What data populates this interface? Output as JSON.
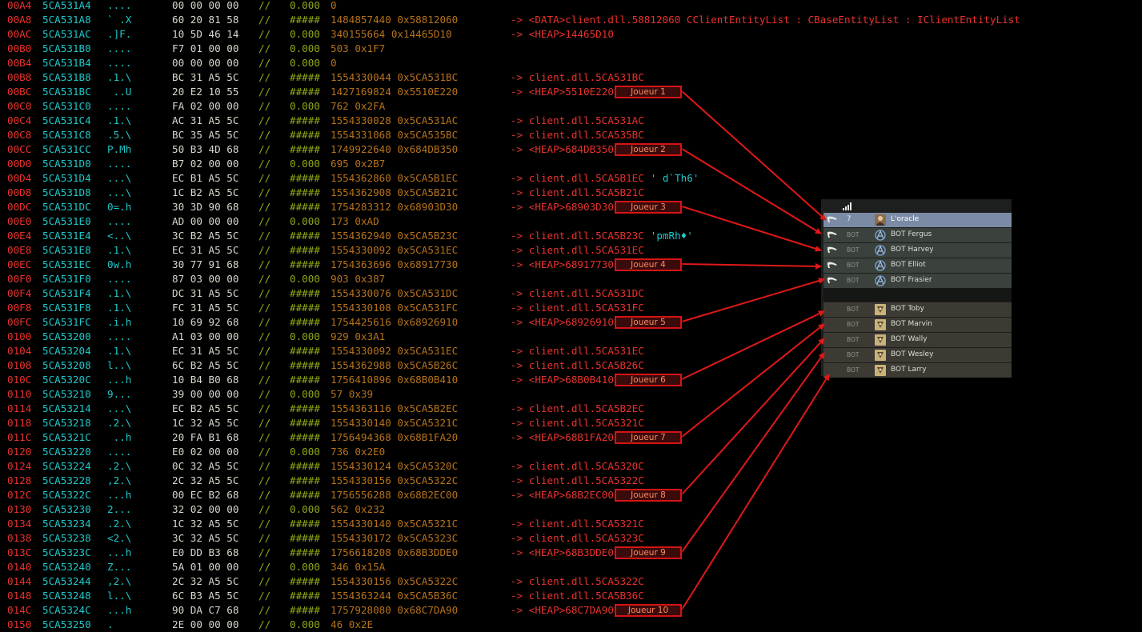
{
  "memory_rows": [
    {
      "off": "00A4",
      "addr": "5CA531A4",
      "ascii": "....",
      "hex": "00 00 00 00",
      "val": "0.000",
      "dec": "0",
      "tgt": "",
      "tail": ""
    },
    {
      "off": "00A8",
      "addr": "5CA531A8",
      "ascii": "` .X",
      "hex": "60 20 81 58",
      "val": "#####",
      "dec": "1484857440 0x58812060",
      "tgt": "-> <DATA>client.dll.58812060 CClientEntityList : CBaseEntityList : IClientEntityList",
      "tail": ""
    },
    {
      "off": "00AC",
      "addr": "5CA531AC",
      "ascii": ".]F.",
      "hex": "10 5D 46 14",
      "val": "0.000",
      "dec": "340155664 0x14465D10",
      "tgt": "-> <HEAP>14465D10",
      "tail": ""
    },
    {
      "off": "00B0",
      "addr": "5CA531B0",
      "ascii": "....",
      "hex": "F7 01 00 00",
      "val": "0.000",
      "dec": "503 0x1F7",
      "tgt": "",
      "tail": ""
    },
    {
      "off": "00B4",
      "addr": "5CA531B4",
      "ascii": "....",
      "hex": "00 00 00 00",
      "val": "0.000",
      "dec": "0",
      "tgt": "",
      "tail": ""
    },
    {
      "off": "00B8",
      "addr": "5CA531B8",
      "ascii": ".1.\\",
      "hex": "BC 31 A5 5C",
      "val": "#####",
      "dec": "1554330044 0x5CA531BC",
      "tgt": "-> client.dll.5CA531BC",
      "tail": ""
    },
    {
      "off": "00BC",
      "addr": "5CA531BC",
      "ascii": " ..U",
      "hex": "20 E2 10 55",
      "val": "#####",
      "dec": "1427169824 0x5510E220",
      "tgt": "-> <HEAP>5510E220",
      "tail": ""
    },
    {
      "off": "00C0",
      "addr": "5CA531C0",
      "ascii": "....",
      "hex": "FA 02 00 00",
      "val": "0.000",
      "dec": "762 0x2FA",
      "tgt": "",
      "tail": ""
    },
    {
      "off": "00C4",
      "addr": "5CA531C4",
      "ascii": ".1.\\",
      "hex": "AC 31 A5 5C",
      "val": "#####",
      "dec": "1554330028 0x5CA531AC",
      "tgt": "-> client.dll.5CA531AC",
      "tail": ""
    },
    {
      "off": "00C8",
      "addr": "5CA531C8",
      "ascii": ".5.\\",
      "hex": "BC 35 A5 5C",
      "val": "#####",
      "dec": "1554331068 0x5CA535BC",
      "tgt": "-> client.dll.5CA535BC",
      "tail": ""
    },
    {
      "off": "00CC",
      "addr": "5CA531CC",
      "ascii": "P.Mh",
      "hex": "50 B3 4D 68",
      "val": "#####",
      "dec": "1749922640 0x684DB350",
      "tgt": "-> <HEAP>684DB350",
      "tail": ""
    },
    {
      "off": "00D0",
      "addr": "5CA531D0",
      "ascii": "....",
      "hex": "B7 02 00 00",
      "val": "0.000",
      "dec": "695 0x2B7",
      "tgt": "",
      "tail": ""
    },
    {
      "off": "00D4",
      "addr": "5CA531D4",
      "ascii": "...\\",
      "hex": "EC B1 A5 5C",
      "val": "#####",
      "dec": "1554362860 0x5CA5B1EC",
      "tgt": "-> client.dll.5CA5B1EC",
      "tail": " ' d`Th6'"
    },
    {
      "off": "00D8",
      "addr": "5CA531D8",
      "ascii": "...\\",
      "hex": "1C B2 A5 5C",
      "val": "#####",
      "dec": "1554362908 0x5CA5B21C",
      "tgt": "-> client.dll.5CA5B21C",
      "tail": ""
    },
    {
      "off": "00DC",
      "addr": "5CA531DC",
      "ascii": "0=.h",
      "hex": "30 3D 90 68",
      "val": "#####",
      "dec": "1754283312 0x68903D30",
      "tgt": "-> <HEAP>68903D30",
      "tail": ""
    },
    {
      "off": "00E0",
      "addr": "5CA531E0",
      "ascii": "....",
      "hex": "AD 00 00 00",
      "val": "0.000",
      "dec": "173 0xAD",
      "tgt": "",
      "tail": ""
    },
    {
      "off": "00E4",
      "addr": "5CA531E4",
      "ascii": "<..\\",
      "hex": "3C B2 A5 5C",
      "val": "#####",
      "dec": "1554362940 0x5CA5B23C",
      "tgt": "-> client.dll.5CA5B23C",
      "tail": " 'pmRh♦'"
    },
    {
      "off": "00E8",
      "addr": "5CA531E8",
      "ascii": ".1.\\",
      "hex": "EC 31 A5 5C",
      "val": "#####",
      "dec": "1554330092 0x5CA531EC",
      "tgt": "-> client.dll.5CA531EC",
      "tail": ""
    },
    {
      "off": "00EC",
      "addr": "5CA531EC",
      "ascii": "0w.h",
      "hex": "30 77 91 68",
      "val": "#####",
      "dec": "1754363696 0x68917730",
      "tgt": "-> <HEAP>68917730",
      "tail": ""
    },
    {
      "off": "00F0",
      "addr": "5CA531F0",
      "ascii": "....",
      "hex": "87 03 00 00",
      "val": "0.000",
      "dec": "903 0x387",
      "tgt": "",
      "tail": ""
    },
    {
      "off": "00F4",
      "addr": "5CA531F4",
      "ascii": ".1.\\",
      "hex": "DC 31 A5 5C",
      "val": "#####",
      "dec": "1554330076 0x5CA531DC",
      "tgt": "-> client.dll.5CA531DC",
      "tail": ""
    },
    {
      "off": "00F8",
      "addr": "5CA531F8",
      "ascii": ".1.\\",
      "hex": "FC 31 A5 5C",
      "val": "#####",
      "dec": "1554330108 0x5CA531FC",
      "tgt": "-> client.dll.5CA531FC",
      "tail": ""
    },
    {
      "off": "00FC",
      "addr": "5CA531FC",
      "ascii": ".i.h",
      "hex": "10 69 92 68",
      "val": "#####",
      "dec": "1754425616 0x68926910",
      "tgt": "-> <HEAP>68926910",
      "tail": ""
    },
    {
      "off": "0100",
      "addr": "5CA53200",
      "ascii": "....",
      "hex": "A1 03 00 00",
      "val": "0.000",
      "dec": "929 0x3A1",
      "tgt": "",
      "tail": ""
    },
    {
      "off": "0104",
      "addr": "5CA53204",
      "ascii": ".1.\\",
      "hex": "EC 31 A5 5C",
      "val": "#####",
      "dec": "1554330092 0x5CA531EC",
      "tgt": "-> client.dll.5CA531EC",
      "tail": ""
    },
    {
      "off": "0108",
      "addr": "5CA53208",
      "ascii": "l..\\",
      "hex": "6C B2 A5 5C",
      "val": "#####",
      "dec": "1554362988 0x5CA5B26C",
      "tgt": "-> client.dll.5CA5B26C",
      "tail": ""
    },
    {
      "off": "010C",
      "addr": "5CA5320C",
      "ascii": "...h",
      "hex": "10 B4 B0 68",
      "val": "#####",
      "dec": "1756410896 0x68B0B410",
      "tgt": "-> <HEAP>68B0B410",
      "tail": ""
    },
    {
      "off": "0110",
      "addr": "5CA53210",
      "ascii": "9...",
      "hex": "39 00 00 00",
      "val": "0.000",
      "dec": "57 0x39",
      "tgt": "",
      "tail": ""
    },
    {
      "off": "0114",
      "addr": "5CA53214",
      "ascii": "...\\",
      "hex": "EC B2 A5 5C",
      "val": "#####",
      "dec": "1554363116 0x5CA5B2EC",
      "tgt": "-> client.dll.5CA5B2EC",
      "tail": ""
    },
    {
      "off": "0118",
      "addr": "5CA53218",
      "ascii": ".2.\\",
      "hex": "1C 32 A5 5C",
      "val": "#####",
      "dec": "1554330140 0x5CA5321C",
      "tgt": "-> client.dll.5CA5321C",
      "tail": ""
    },
    {
      "off": "011C",
      "addr": "5CA5321C",
      "ascii": " ..h",
      "hex": "20 FA B1 68",
      "val": "#####",
      "dec": "1756494368 0x68B1FA20",
      "tgt": "-> <HEAP>68B1FA20",
      "tail": ""
    },
    {
      "off": "0120",
      "addr": "5CA53220",
      "ascii": "....",
      "hex": "E0 02 00 00",
      "val": "0.000",
      "dec": "736 0x2E0",
      "tgt": "",
      "tail": ""
    },
    {
      "off": "0124",
      "addr": "5CA53224",
      "ascii": ".2.\\",
      "hex": "0C 32 A5 5C",
      "val": "#####",
      "dec": "1554330124 0x5CA5320C",
      "tgt": "-> client.dll.5CA5320C",
      "tail": ""
    },
    {
      "off": "0128",
      "addr": "5CA53228",
      "ascii": ",2.\\",
      "hex": "2C 32 A5 5C",
      "val": "#####",
      "dec": "1554330156 0x5CA5322C",
      "tgt": "-> client.dll.5CA5322C",
      "tail": ""
    },
    {
      "off": "012C",
      "addr": "5CA5322C",
      "ascii": "...h",
      "hex": "00 EC B2 68",
      "val": "#####",
      "dec": "1756556288 0x68B2EC00",
      "tgt": "-> <HEAP>68B2EC00",
      "tail": ""
    },
    {
      "off": "0130",
      "addr": "5CA53230",
      "ascii": "2...",
      "hex": "32 02 00 00",
      "val": "0.000",
      "dec": "562 0x232",
      "tgt": "",
      "tail": ""
    },
    {
      "off": "0134",
      "addr": "5CA53234",
      "ascii": ".2.\\",
      "hex": "1C 32 A5 5C",
      "val": "#####",
      "dec": "1554330140 0x5CA5321C",
      "tgt": "-> client.dll.5CA5321C",
      "tail": ""
    },
    {
      "off": "0138",
      "addr": "5CA53238",
      "ascii": "<2.\\",
      "hex": "3C 32 A5 5C",
      "val": "#####",
      "dec": "1554330172 0x5CA5323C",
      "tgt": "-> client.dll.5CA5323C",
      "tail": ""
    },
    {
      "off": "013C",
      "addr": "5CA5323C",
      "ascii": "...h",
      "hex": "E0 DD B3 68",
      "val": "#####",
      "dec": "1756618208 0x68B3DDE0",
      "tgt": "-> <HEAP>68B3DDE0",
      "tail": ""
    },
    {
      "off": "0140",
      "addr": "5CA53240",
      "ascii": "Z...",
      "hex": "5A 01 00 00",
      "val": "0.000",
      "dec": "346 0x15A",
      "tgt": "",
      "tail": ""
    },
    {
      "off": "0144",
      "addr": "5CA53244",
      "ascii": ",2.\\",
      "hex": "2C 32 A5 5C",
      "val": "#####",
      "dec": "1554330156 0x5CA5322C",
      "tgt": "-> client.dll.5CA5322C",
      "tail": ""
    },
    {
      "off": "0148",
      "addr": "5CA53248",
      "ascii": "l..\\",
      "hex": "6C B3 A5 5C",
      "val": "#####",
      "dec": "1554363244 0x5CA5B36C",
      "tgt": "-> client.dll.5CA5B36C",
      "tail": ""
    },
    {
      "off": "014C",
      "addr": "5CA5324C",
      "ascii": "...h",
      "hex": "90 DA C7 68",
      "val": "#####",
      "dec": "1757928080 0x68C7DA90",
      "tgt": "-> <HEAP>68C7DA90",
      "tail": ""
    },
    {
      "off": "0150",
      "addr": "5CA53250",
      "ascii": ".",
      "hex": "2E 00 00 00",
      "val": "0.000",
      "dec": "46 0x2E",
      "tgt": "",
      "tail": ""
    }
  ],
  "separator": "//",
  "markers": [
    {
      "label": "Joueur 1",
      "row": 6
    },
    {
      "label": "Joueur 2",
      "row": 10
    },
    {
      "label": "Joueur 3",
      "row": 14
    },
    {
      "label": "Joueur 4",
      "row": 18
    },
    {
      "label": "Joueur 5",
      "row": 22
    },
    {
      "label": "Joueur 6",
      "row": 26
    },
    {
      "label": "Joueur 7",
      "row": 30
    },
    {
      "label": "Joueur 8",
      "row": 34
    },
    {
      "label": "Joueur 9",
      "row": 38
    },
    {
      "label": "Joueur 10",
      "row": 42
    }
  ],
  "scoreboard": {
    "ct_players": [
      {
        "ping": "7",
        "name": "L'oracle",
        "avatar": "portrait-icon"
      },
      {
        "ping": "BOT",
        "name": "BOT Fergus",
        "avatar": "ct-logo-icon"
      },
      {
        "ping": "BOT",
        "name": "BOT Harvey",
        "avatar": "ct-logo-icon"
      },
      {
        "ping": "BOT",
        "name": "BOT Elliot",
        "avatar": "ct-logo-icon"
      },
      {
        "ping": "BOT",
        "name": "BOT Frasier",
        "avatar": "ct-logo-icon"
      }
    ],
    "t_players": [
      {
        "ping": "BOT",
        "name": "BOT Toby",
        "avatar": "t-logo-icon"
      },
      {
        "ping": "BOT",
        "name": "BOT Marvin",
        "avatar": "t-logo-icon"
      },
      {
        "ping": "BOT",
        "name": "BOT Wally",
        "avatar": "t-logo-icon"
      },
      {
        "ping": "BOT",
        "name": "BOT Wesley",
        "avatar": "t-logo-icon"
      },
      {
        "ping": "BOT",
        "name": "BOT Larry",
        "avatar": "t-logo-icon"
      }
    ]
  },
  "colors": {
    "offset": "#e8322e",
    "address": "#1fc7c7",
    "hex": "#d8d8cc",
    "value": "#8fa818",
    "decimal": "#b6721a",
    "pointer": "#e8322e",
    "marker_border": "#d41414",
    "arrow": "#e01818",
    "scoreboard_highlight": "#7b8ba6"
  }
}
